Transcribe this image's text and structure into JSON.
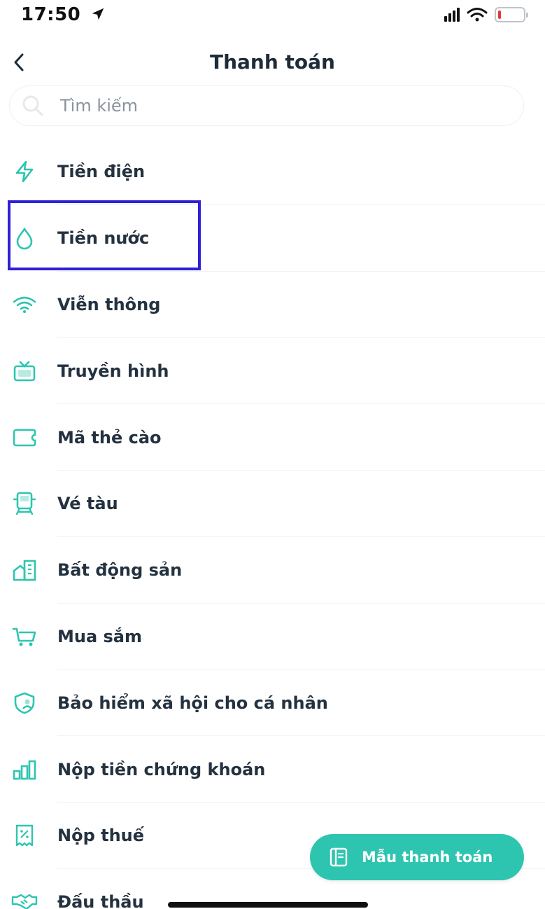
{
  "status_bar": {
    "time": "17:50",
    "location_icon": "location-arrow-icon",
    "signal_icon": "cellular-signal-icon",
    "wifi_icon": "wifi-icon",
    "battery_icon": "battery-icon"
  },
  "header": {
    "back_icon": "chevron-left-icon",
    "title": "Thanh toán"
  },
  "search": {
    "placeholder": "Tìm kiếm",
    "icon": "search-icon"
  },
  "menu": {
    "items": [
      {
        "label": "Tiền điện",
        "icon": "lightning-icon"
      },
      {
        "label": "Tiền nước",
        "icon": "water-drop-icon",
        "highlighted": true
      },
      {
        "label": "Viễn thông",
        "icon": "wifi-icon"
      },
      {
        "label": "Truyền hình",
        "icon": "tv-icon"
      },
      {
        "label": "Mã thẻ cào",
        "icon": "card-icon"
      },
      {
        "label": "Vé tàu",
        "icon": "train-icon"
      },
      {
        "label": "Bất động sản",
        "icon": "building-icon"
      },
      {
        "label": "Mua sắm",
        "icon": "shopping-cart-icon"
      },
      {
        "label": "Bảo hiểm xã hội cho cá nhân",
        "icon": "shield-user-icon"
      },
      {
        "label": "Nộp tiền chứng khoán",
        "icon": "bar-chart-icon"
      },
      {
        "label": "Nộp thuế",
        "icon": "tax-receipt-icon"
      },
      {
        "label": "Đấu thầu",
        "icon": "handshake-icon"
      }
    ]
  },
  "fab": {
    "label": "Mẫu thanh toán",
    "icon": "template-book-icon"
  },
  "colors": {
    "accent": "#2ec5b0",
    "highlight_border": "#2f20d8",
    "text": "#243240"
  }
}
